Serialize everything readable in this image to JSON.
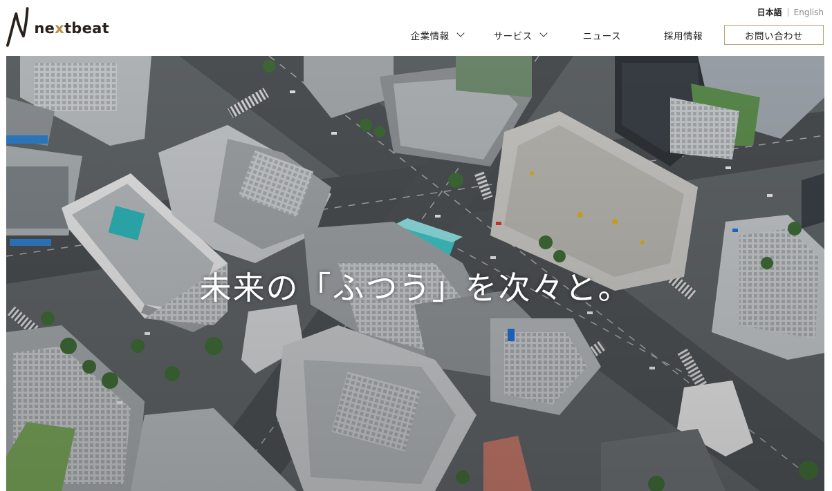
{
  "header": {
    "logo_text_pre": "ne",
    "logo_text_x": "x",
    "logo_text_post": "tbeat",
    "lang_ja": "日本語",
    "lang_en": "English",
    "nav": {
      "company": "企業情報",
      "service": "サービス",
      "news": "ニュース",
      "recruit": "採用情報",
      "contact": "お問い合わせ"
    }
  },
  "hero": {
    "title": "未来の「ふつう」を次々と。"
  },
  "colors": {
    "accent_gold": "#b8a27a",
    "logo_dark": "#2a211c"
  }
}
